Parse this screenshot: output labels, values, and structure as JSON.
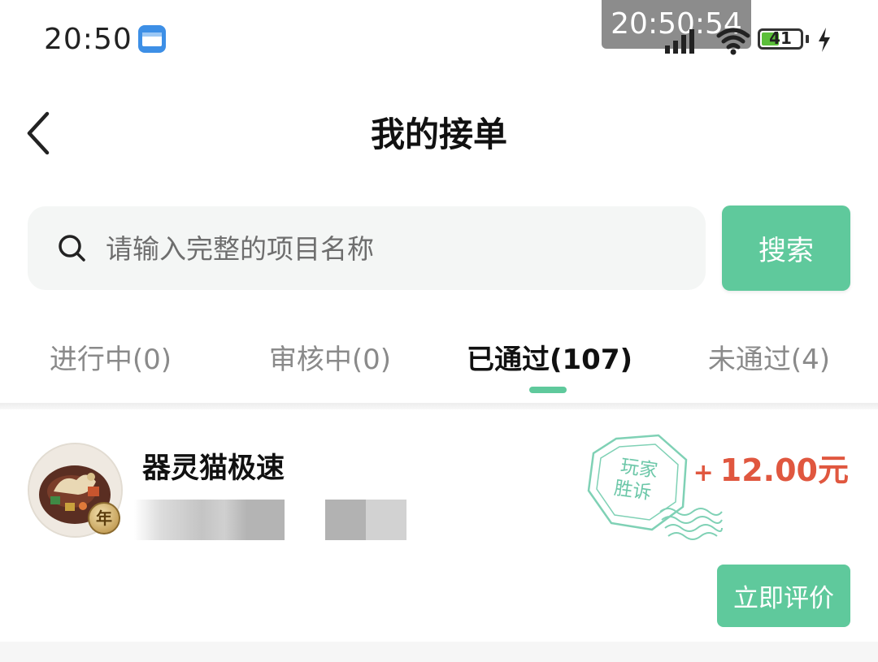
{
  "status_bar": {
    "time": "20:50",
    "clock_overlay": "20:50:54",
    "battery_level": "41",
    "icons": [
      "app-icon",
      "signal-icon",
      "wifi-icon",
      "battery-icon",
      "charging-icon"
    ]
  },
  "header": {
    "title": "我的接单",
    "back_icon": "chevron-left-icon"
  },
  "search": {
    "placeholder": "请输入完整的项目名称",
    "value": "",
    "button_label": "搜索"
  },
  "tabs": [
    {
      "label": "进行中(0)",
      "active": false
    },
    {
      "label": "审核中(0)",
      "active": false
    },
    {
      "label": "已通过(107)",
      "active": true
    },
    {
      "label": "未通过(4)",
      "active": false
    }
  ],
  "orders": [
    {
      "name": "器灵猫极速",
      "amount_sign": "+",
      "amount": "12.00元",
      "stamp_text_line1": "玩家",
      "stamp_text_line2": "胜诉",
      "badge": "年",
      "action_label": "立即评价"
    }
  ],
  "colors": {
    "accent": "#5fc99c",
    "amount": "#e0573f",
    "stamp": "#7fd1b5"
  }
}
